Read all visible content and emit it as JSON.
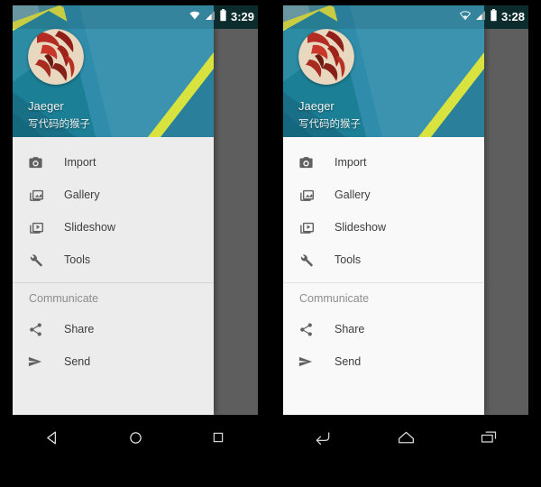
{
  "meta": {
    "description": "Side-by-side Android navigation drawer screenshots",
    "drawer_bg_left": "#ececec",
    "drawer_bg_right": "#f9f9f9",
    "scrim_color": "#5e5e5e",
    "accent_teal": "#1d7c93",
    "icon_color": "#616161",
    "label_color": "#3d3d3d",
    "subheader_color": "#8d8d8d"
  },
  "phones": [
    {
      "id": "left",
      "status_bar": {
        "clock": "3:29",
        "wifi_icon": "wifi-filled-icon",
        "signal_icon": "signal-triangle-icon",
        "battery_icon": "battery-icon"
      },
      "nav_bar": {
        "style": "lollipop",
        "buttons": [
          {
            "name": "back-button",
            "icon": "triangle-back-icon"
          },
          {
            "name": "home-button",
            "icon": "circle-home-icon"
          },
          {
            "name": "recents-button",
            "icon": "square-recents-icon"
          }
        ]
      },
      "drawer": {
        "header": {
          "name": "Jaeger",
          "subtitle": "写代码的猴子",
          "avatar": "user-avatar"
        },
        "items": [
          {
            "label": "Import",
            "icon": "camera-icon"
          },
          {
            "label": "Gallery",
            "icon": "gallery-icon"
          },
          {
            "label": "Slideshow",
            "icon": "slideshow-icon"
          },
          {
            "label": "Tools",
            "icon": "wrench-icon"
          }
        ],
        "subheader": "Communicate",
        "items2": [
          {
            "label": "Share",
            "icon": "share-icon"
          },
          {
            "label": "Send",
            "icon": "send-icon"
          }
        ]
      }
    },
    {
      "id": "right",
      "status_bar": {
        "clock": "3:28",
        "wifi_icon": "wifi-outline-icon",
        "signal_icon": "signal-triangle-icon",
        "battery_icon": "battery-icon"
      },
      "nav_bar": {
        "style": "kitkat",
        "buttons": [
          {
            "name": "back-button",
            "icon": "arrow-back-icon"
          },
          {
            "name": "home-button",
            "icon": "pentagon-home-icon"
          },
          {
            "name": "recents-button",
            "icon": "stacked-recents-icon"
          }
        ]
      },
      "drawer": {
        "header": {
          "name": "Jaeger",
          "subtitle": "写代码的猴子",
          "avatar": "user-avatar"
        },
        "items": [
          {
            "label": "Import",
            "icon": "camera-icon"
          },
          {
            "label": "Gallery",
            "icon": "gallery-icon"
          },
          {
            "label": "Slideshow",
            "icon": "slideshow-icon"
          },
          {
            "label": "Tools",
            "icon": "wrench-icon"
          }
        ],
        "subheader": "Communicate",
        "items2": [
          {
            "label": "Share",
            "icon": "share-icon"
          },
          {
            "label": "Send",
            "icon": "send-icon"
          }
        ]
      }
    }
  ]
}
